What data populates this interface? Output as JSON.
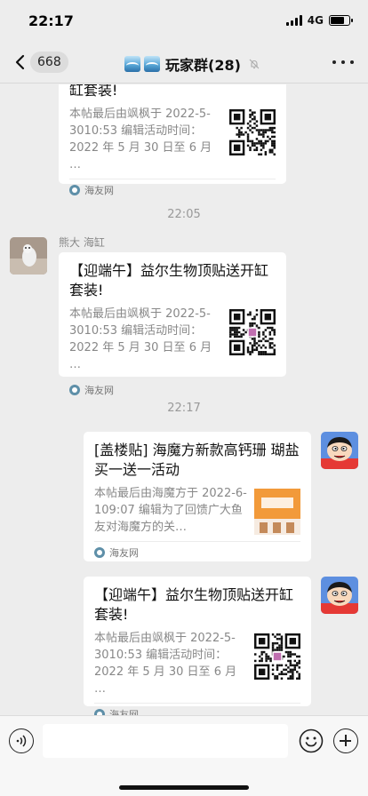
{
  "status_bar": {
    "time": "22:17",
    "network": "4G",
    "battery_level": 0.75
  },
  "nav": {
    "unread_count": "668",
    "group_name": "玩家群(28)"
  },
  "messages": [
    {
      "title": "缸套装!",
      "desc": "本帖最后由飒枫于 2022-5-3010:53 编辑活动时间：2022 年 5 月 30 日至 6 月 …",
      "source": "海友网"
    },
    {
      "timestamp": "22:05"
    },
    {
      "sender": "熊大 海缸",
      "title": "【迎端午】益尔生物顶贴送开缸套装!",
      "desc": "本帖最后由飒枫于 2022-5-3010:53 编辑活动时间：2022 年 5 月 30 日至 6 月 …",
      "source": "海友网"
    },
    {
      "timestamp": "22:17"
    },
    {
      "title": "[盖楼贴] 海魔方新款高钙珊 瑚盐买一送一活动",
      "desc": "本帖最后由海魔方于 2022-6-109:07 编辑为了回馈广大鱼友对海魔方的关…",
      "source": "海友网"
    },
    {
      "title": "【迎端午】益尔生物顶贴送开缸套装!",
      "desc": "本帖最后由飒枫于 2022-5-3010:53 编辑活动时间：2022 年 5 月 30 日至 6 月 …",
      "source": "海友网"
    }
  ],
  "icons": {
    "back": "chevron-left-icon",
    "mute": "bell-slash-icon",
    "more": "ellipsis-icon",
    "voice": "voice-icon",
    "emoji": "smiley-icon",
    "plus": "plus-circle-icon",
    "source": "haiyou-logo-icon"
  },
  "colors": {
    "background": "#ededed",
    "card": "#ffffff",
    "timestamp": "#999999",
    "source_icon": "#5e8fa8"
  }
}
